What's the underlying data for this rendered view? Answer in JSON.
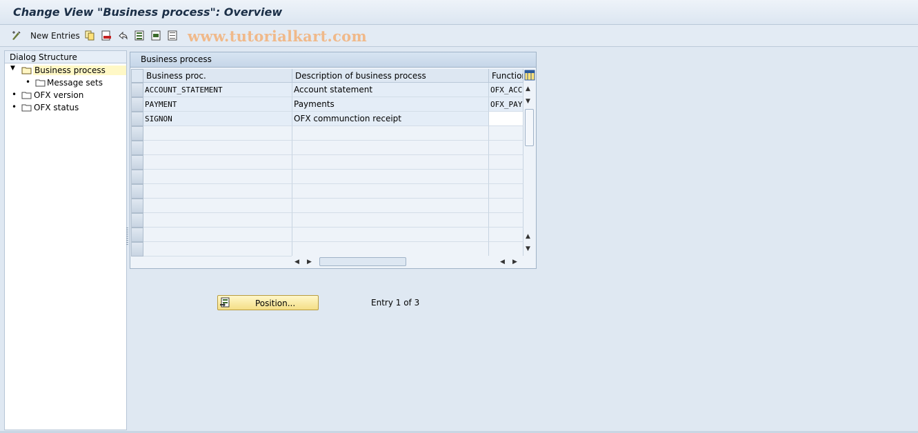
{
  "window": {
    "title": "Change View \"Business process\": Overview",
    "watermark": "www.tutorialkart.com"
  },
  "toolbar": {
    "new_entries_label": "New Entries",
    "icons": [
      "display-change-icon",
      "copy-icon",
      "delete-icon",
      "undo-icon",
      "select-all-icon",
      "select-block-icon",
      "deselect-all-icon"
    ]
  },
  "dialog_structure": {
    "header": "Dialog Structure",
    "items": [
      {
        "label": "Business process",
        "level": 0,
        "expanded": true,
        "selected": true
      },
      {
        "label": "Message sets",
        "level": 1,
        "expanded": false,
        "selected": false
      },
      {
        "label": "OFX version",
        "level": 0,
        "expanded": false,
        "selected": false
      },
      {
        "label": "OFX status",
        "level": 0,
        "expanded": false,
        "selected": false
      }
    ]
  },
  "table": {
    "title": "Business process",
    "columns": [
      "Business proc.",
      "Description of business process",
      "Function"
    ],
    "rows": [
      [
        "ACCOUNT_STATEMENT",
        "Account statement",
        "OFX_ACC"
      ],
      [
        "PAYMENT",
        "Payments",
        "OFX_PAY"
      ],
      [
        "SIGNON",
        "OFX communction receipt",
        ""
      ]
    ],
    "empty_rows": 9
  },
  "footer": {
    "position_button_label": "Position...",
    "entry_text": "Entry 1 of 3"
  },
  "colors": {
    "background": "#dfe8f2",
    "selected_tree_item": "#fff8c6",
    "button_yellow": "#f4de86"
  }
}
